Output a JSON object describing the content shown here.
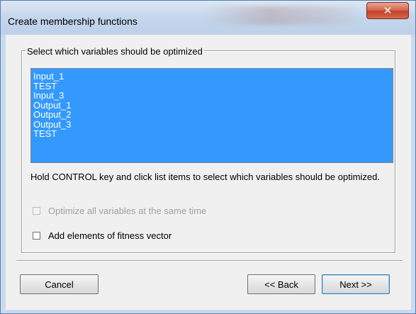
{
  "window": {
    "title": "Create membership functions",
    "close_glyph": "✕"
  },
  "group": {
    "label": "Select which variables should be optimized"
  },
  "variables": {
    "items": [
      "Input_1",
      "TEST",
      "Input_3",
      "Output_1",
      "Output_2",
      "Output_3",
      "TEST"
    ],
    "all_selected": true,
    "selection_color": "#3399ff"
  },
  "hint": "Hold CONTROL key and click list items to select which variables should be optimized.",
  "options": {
    "optimize_all_label": "Optimize all variables at the same time",
    "optimize_all_enabled": false,
    "optimize_all_checked": false,
    "fitness_label": "Add elements of fitness vector",
    "fitness_checked": false
  },
  "buttons": {
    "cancel": "Cancel",
    "back": "<< Back",
    "next": "Next >>"
  }
}
